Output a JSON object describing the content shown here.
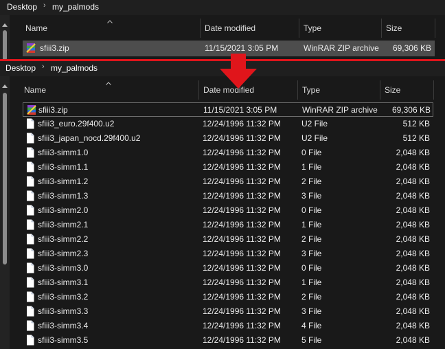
{
  "top_panel": {
    "breadcrumb": [
      "Desktop",
      "my_palmods"
    ],
    "columns": [
      "Name",
      "Date modified",
      "Type",
      "Size"
    ],
    "rows": [
      {
        "name": "sfiii3.zip",
        "date": "11/15/2021 3:05 PM",
        "type": "WinRAR ZIP archive",
        "size": "69,306 KB",
        "icon": "winrar-archive-icon",
        "selected": true
      }
    ]
  },
  "bottom_panel": {
    "breadcrumb": [
      "Desktop",
      "my_palmods"
    ],
    "columns": [
      "Name",
      "Date modified",
      "Type",
      "Size"
    ],
    "rows": [
      {
        "name": "sfiii3.zip",
        "date": "11/15/2021 3:05 PM",
        "type": "WinRAR ZIP archive",
        "size": "69,306 KB",
        "icon": "winrar-archive-icon",
        "focused": true
      },
      {
        "name": "sfiii3_euro.29f400.u2",
        "date": "12/24/1996 11:32 PM",
        "type": "U2 File",
        "size": "512 KB",
        "icon": "file-icon"
      },
      {
        "name": "sfiii3_japan_nocd.29f400.u2",
        "date": "12/24/1996 11:32 PM",
        "type": "U2 File",
        "size": "512 KB",
        "icon": "file-icon"
      },
      {
        "name": "sfiii3-simm1.0",
        "date": "12/24/1996 11:32 PM",
        "type": "0 File",
        "size": "2,048 KB",
        "icon": "file-icon"
      },
      {
        "name": "sfiii3-simm1.1",
        "date": "12/24/1996 11:32 PM",
        "type": "1 File",
        "size": "2,048 KB",
        "icon": "file-icon"
      },
      {
        "name": "sfiii3-simm1.2",
        "date": "12/24/1996 11:32 PM",
        "type": "2 File",
        "size": "2,048 KB",
        "icon": "file-icon"
      },
      {
        "name": "sfiii3-simm1.3",
        "date": "12/24/1996 11:32 PM",
        "type": "3 File",
        "size": "2,048 KB",
        "icon": "file-icon"
      },
      {
        "name": "sfiii3-simm2.0",
        "date": "12/24/1996 11:32 PM",
        "type": "0 File",
        "size": "2,048 KB",
        "icon": "file-icon"
      },
      {
        "name": "sfiii3-simm2.1",
        "date": "12/24/1996 11:32 PM",
        "type": "1 File",
        "size": "2,048 KB",
        "icon": "file-icon"
      },
      {
        "name": "sfiii3-simm2.2",
        "date": "12/24/1996 11:32 PM",
        "type": "2 File",
        "size": "2,048 KB",
        "icon": "file-icon"
      },
      {
        "name": "sfiii3-simm2.3",
        "date": "12/24/1996 11:32 PM",
        "type": "3 File",
        "size": "2,048 KB",
        "icon": "file-icon"
      },
      {
        "name": "sfiii3-simm3.0",
        "date": "12/24/1996 11:32 PM",
        "type": "0 File",
        "size": "2,048 KB",
        "icon": "file-icon"
      },
      {
        "name": "sfiii3-simm3.1",
        "date": "12/24/1996 11:32 PM",
        "type": "1 File",
        "size": "2,048 KB",
        "icon": "file-icon"
      },
      {
        "name": "sfiii3-simm3.2",
        "date": "12/24/1996 11:32 PM",
        "type": "2 File",
        "size": "2,048 KB",
        "icon": "file-icon"
      },
      {
        "name": "sfiii3-simm3.3",
        "date": "12/24/1996 11:32 PM",
        "type": "3 File",
        "size": "2,048 KB",
        "icon": "file-icon"
      },
      {
        "name": "sfiii3-simm3.4",
        "date": "12/24/1996 11:32 PM",
        "type": "4 File",
        "size": "2,048 KB",
        "icon": "file-icon"
      },
      {
        "name": "sfiii3-simm3.5",
        "date": "12/24/1996 11:32 PM",
        "type": "5 File",
        "size": "2,048 KB",
        "icon": "file-icon"
      }
    ]
  },
  "colors": {
    "background": "#191919",
    "selection": "#4d4d4d",
    "annotation_red": "#e0151b"
  }
}
